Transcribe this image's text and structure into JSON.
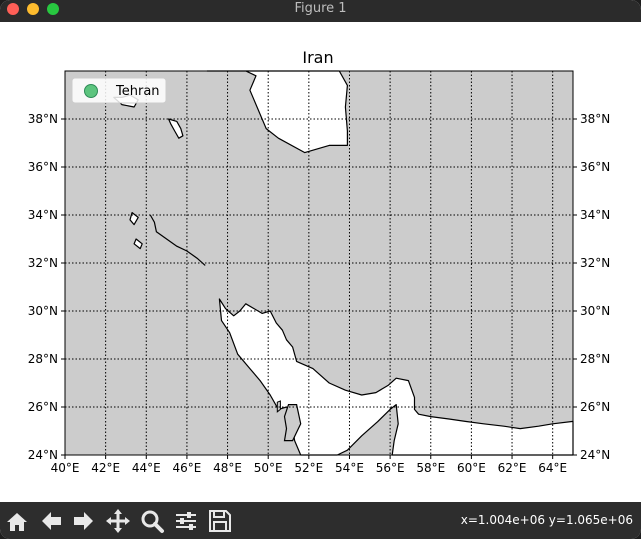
{
  "window": {
    "title": "Figure 1"
  },
  "traffic_lights": {
    "close_color": "#ff5f57",
    "minimize_color": "#febc2e",
    "zoom_color": "#28c840"
  },
  "chart_data": {
    "type": "map",
    "title": "Iran",
    "projection": "plate-carree",
    "lon_range": [
      40,
      65
    ],
    "lat_range": [
      24,
      40
    ],
    "lon_ticks": [
      40,
      42,
      44,
      46,
      48,
      50,
      52,
      54,
      56,
      58,
      60,
      62,
      64
    ],
    "lon_labels": [
      "40°E",
      "42°E",
      "44°E",
      "46°E",
      "48°E",
      "50°E",
      "52°E",
      "54°E",
      "56°E",
      "58°E",
      "60°E",
      "62°E",
      "64°E"
    ],
    "lat_ticks": [
      24,
      26,
      28,
      30,
      32,
      34,
      36,
      38
    ],
    "lat_labels": [
      "24°N",
      "26°N",
      "28°N",
      "30°N",
      "32°N",
      "34°N",
      "36°N",
      "38°N"
    ],
    "grid": true,
    "grid_style": "dotted",
    "land_color": "#cccccc",
    "water_color": "#ffffff",
    "legend": {
      "position": "upper-left",
      "entries": [
        {
          "label": "Tehran",
          "marker": "circle",
          "color": "#5cc47e"
        }
      ]
    }
  },
  "toolbar": {
    "icons": [
      "home-icon",
      "back-arrow-icon",
      "forward-arrow-icon",
      "pan-icon",
      "zoom-icon",
      "configure-subplots-icon",
      "save-icon"
    ],
    "coords_text": "x=1.004e+06 y=1.065e+06"
  }
}
